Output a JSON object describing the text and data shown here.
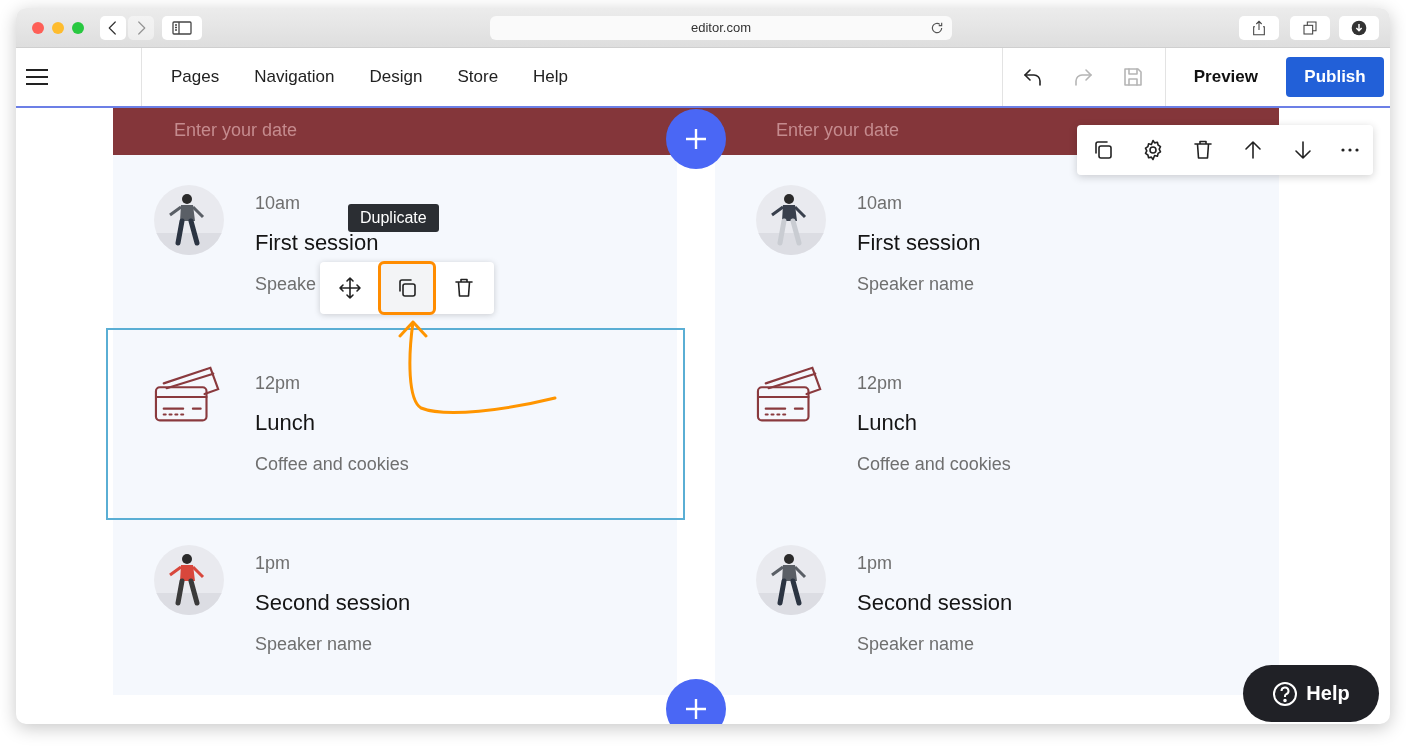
{
  "browser": {
    "url": "editor.com",
    "nav": [
      {
        "kind": "back",
        "disabled": false
      },
      {
        "kind": "forward",
        "disabled": true
      }
    ]
  },
  "toolbar": {
    "menu": [
      "Pages",
      "Navigation",
      "Design",
      "Store",
      "Help"
    ],
    "actions": [
      {
        "kind": "undo",
        "disabled": false
      },
      {
        "kind": "redo",
        "disabled": true
      },
      {
        "kind": "save",
        "disabled": true
      }
    ],
    "preview": "Preview",
    "publish": "Publish"
  },
  "section_toolbar": [
    {
      "kind": "duplicate"
    },
    {
      "kind": "settings"
    },
    {
      "kind": "delete"
    },
    {
      "kind": "up"
    },
    {
      "kind": "down"
    },
    {
      "kind": "more"
    }
  ],
  "columns": [
    {
      "date_placeholder": "Enter your date",
      "items": [
        {
          "time": "10am",
          "title": "First session",
          "subtitle": "Speake",
          "selected": false
        },
        {
          "kind": "icon",
          "time": "12pm",
          "title": "Lunch",
          "subtitle": "Coffee and cookies",
          "selected": true
        },
        {
          "time": "1pm",
          "title": "Second session",
          "subtitle": "Speaker name",
          "selected": false
        }
      ]
    },
    {
      "date_placeholder": "Enter your date",
      "items": [
        {
          "time": "10am",
          "title": "First session",
          "subtitle": "Speaker name",
          "selected": false
        },
        {
          "kind": "icon",
          "time": "12pm",
          "title": "Lunch",
          "subtitle": "Coffee and cookies",
          "selected": false
        },
        {
          "time": "1pm",
          "title": "Second session",
          "subtitle": "Speaker name",
          "selected": false
        }
      ]
    }
  ],
  "element_toolbar": {
    "tooltip": "Duplicate",
    "actions": [
      {
        "kind": "move",
        "selected": false
      },
      {
        "kind": "duplicate",
        "selected": true
      },
      {
        "kind": "delete",
        "selected": false
      }
    ]
  },
  "help_button": "Help"
}
